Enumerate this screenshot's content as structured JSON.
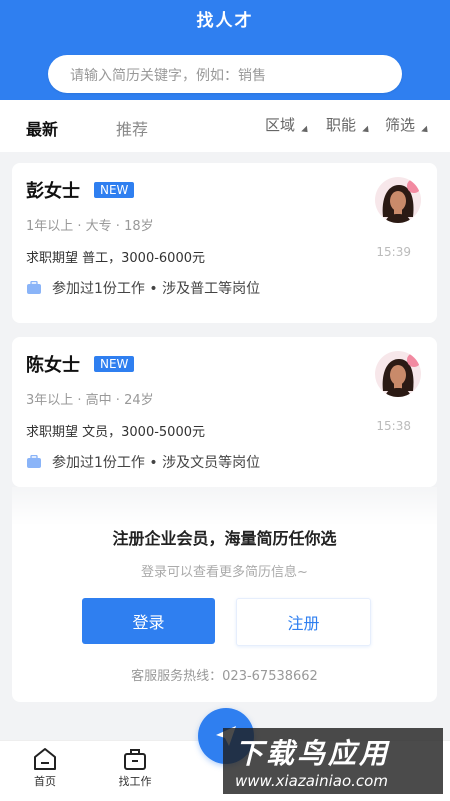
{
  "header": {
    "title": "找人才"
  },
  "search": {
    "placeholder": "请输入简历关键字，例如：销售"
  },
  "tabs": [
    {
      "label": "最新"
    },
    {
      "label": "推荐"
    }
  ],
  "filters": [
    {
      "label": "区域"
    },
    {
      "label": "职能"
    },
    {
      "label": "筛选"
    }
  ],
  "candidates": [
    {
      "name": "彭女士",
      "badge": "NEW",
      "meta": "1年以上 · 大专 · 18岁",
      "expect": "求职期望 普工，3000-6000元",
      "history": "参加过1份工作 • 涉及普工等岗位",
      "time": "15:39"
    },
    {
      "name": "陈女士",
      "badge": "NEW",
      "meta": "3年以上 · 高中 · 24岁",
      "expect": "求职期望 文员，3000-5000元",
      "history": "参加过1份工作 • 涉及文员等岗位",
      "time": "15:38"
    }
  ],
  "prompt": {
    "title": "注册企业会员，海量简历任你选",
    "subtitle": "登录可以查看更多简历信息~",
    "login_label": "登录",
    "register_label": "注册",
    "hotline": "客服服务热线：023-67538662"
  },
  "bottom_nav": [
    {
      "label": "首页"
    },
    {
      "label": "找工作"
    },
    {
      "label": ""
    }
  ],
  "watermark": {
    "line1": "下载鸟应用",
    "line2": "www.xiazainiao.com"
  },
  "colors": {
    "primary": "#2f7ff0",
    "background": "#f2f3f5"
  }
}
